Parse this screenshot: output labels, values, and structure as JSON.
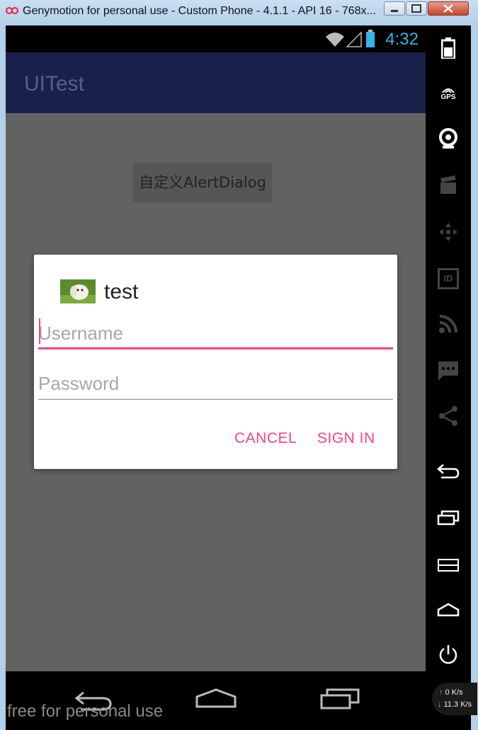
{
  "window": {
    "title": "Genymotion for personal use - Custom Phone - 4.1.1 - API 16 - 768x..."
  },
  "statusbar": {
    "time": "4:32"
  },
  "app": {
    "title": "UITest",
    "button_label": "自定义AlertDialog"
  },
  "dialog": {
    "title": "test",
    "username_placeholder": "Username",
    "password_placeholder": "Password",
    "cancel_label": "CANCEL",
    "signin_label": "SIGN IN"
  },
  "watermark": "free for personal use",
  "sidebar": {
    "gps_label": "GPS",
    "id_label": "ID",
    "icons": [
      "battery-icon",
      "gps-icon",
      "camera-icon",
      "media-icon",
      "dpad-icon",
      "id-icon",
      "rss-icon",
      "sms-icon",
      "share-icon",
      "back-icon",
      "recent-apps-icon",
      "menu-icon",
      "home-icon",
      "power-icon"
    ]
  },
  "netmeter": {
    "upload": "0 K/s",
    "download": "11.3 K/s"
  },
  "colors": {
    "accent": "#ff4081",
    "appbar": "#19214b",
    "clock": "#33b5e5"
  }
}
